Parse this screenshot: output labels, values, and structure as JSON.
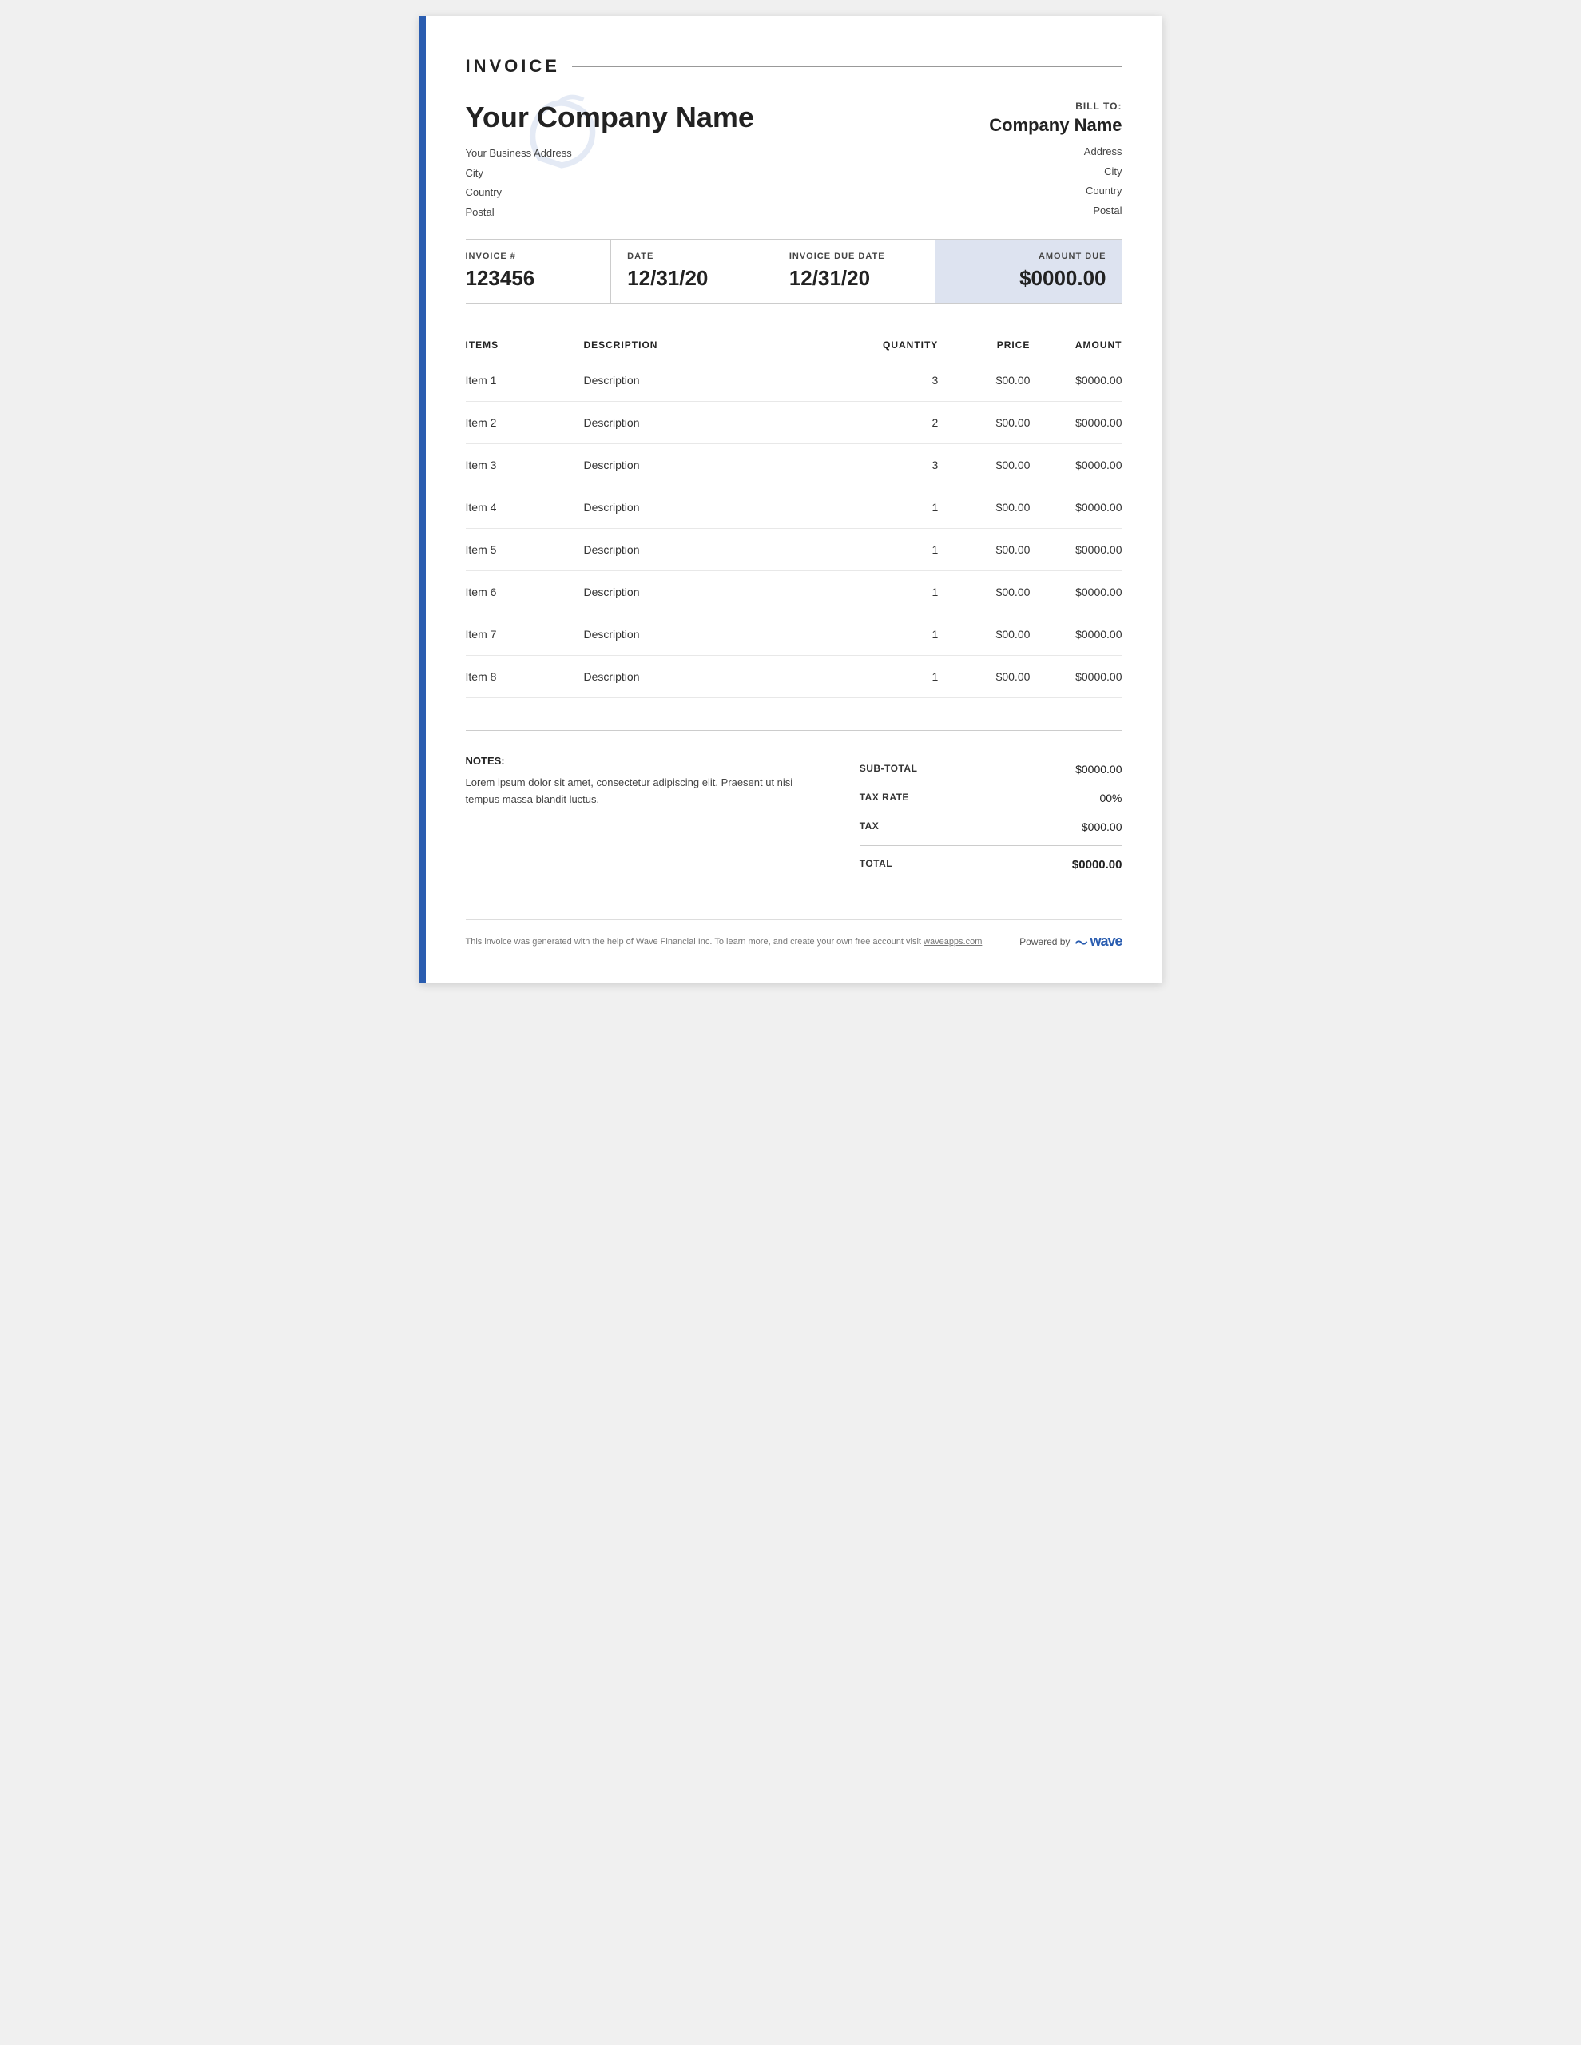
{
  "header": {
    "invoice_title": "INVOICE",
    "company_name": "Your Company Name",
    "company_address_line1": "Your Business Address",
    "company_city": "City",
    "company_country": "Country",
    "company_postal": "Postal"
  },
  "bill_to": {
    "label": "BILL TO:",
    "company_name": "Company Name",
    "address": "Address",
    "city": "City",
    "country": "Country",
    "postal": "Postal"
  },
  "invoice_details": {
    "invoice_number_label": "INVOICE #",
    "invoice_number": "123456",
    "date_label": "DATE",
    "date": "12/31/20",
    "due_date_label": "INVOICE DUE DATE",
    "due_date": "12/31/20",
    "amount_due_label": "AMOUNT DUE",
    "amount_due": "$0000.00"
  },
  "table": {
    "headers": {
      "items": "ITEMS",
      "description": "DESCRIPTION",
      "quantity": "QUANTITY",
      "price": "PRICE",
      "amount": "AMOUNT"
    },
    "rows": [
      {
        "name": "Item 1",
        "description": "Description",
        "quantity": "3",
        "price": "$00.00",
        "amount": "$0000.00"
      },
      {
        "name": "Item 2",
        "description": "Description",
        "quantity": "2",
        "price": "$00.00",
        "amount": "$0000.00"
      },
      {
        "name": "Item 3",
        "description": "Description",
        "quantity": "3",
        "price": "$00.00",
        "amount": "$0000.00"
      },
      {
        "name": "Item 4",
        "description": "Description",
        "quantity": "1",
        "price": "$00.00",
        "amount": "$0000.00"
      },
      {
        "name": "Item 5",
        "description": "Description",
        "quantity": "1",
        "price": "$00.00",
        "amount": "$0000.00"
      },
      {
        "name": "Item 6",
        "description": "Description",
        "quantity": "1",
        "price": "$00.00",
        "amount": "$0000.00"
      },
      {
        "name": "Item 7",
        "description": "Description",
        "quantity": "1",
        "price": "$00.00",
        "amount": "$0000.00"
      },
      {
        "name": "Item 8",
        "description": "Description",
        "quantity": "1",
        "price": "$00.00",
        "amount": "$0000.00"
      }
    ]
  },
  "notes": {
    "label": "NOTES:",
    "text": "Lorem ipsum dolor sit amet, consectetur adipiscing elit. Praesent ut nisi tempus massa blandit luctus."
  },
  "totals": {
    "subtotal_label": "SUB-TOTAL",
    "subtotal_value": "$0000.00",
    "tax_rate_label": "TAX RATE",
    "tax_rate_value": "00%",
    "tax_label": "TAX",
    "tax_value": "$000.00",
    "total_label": "TOTAL",
    "total_value": "$0000.00"
  },
  "footer": {
    "note": "This invoice was generated with the help of Wave Financial Inc. To learn more, and create your own free account visit waveapps.com",
    "powered_by": "Powered by",
    "wave": "wave"
  }
}
